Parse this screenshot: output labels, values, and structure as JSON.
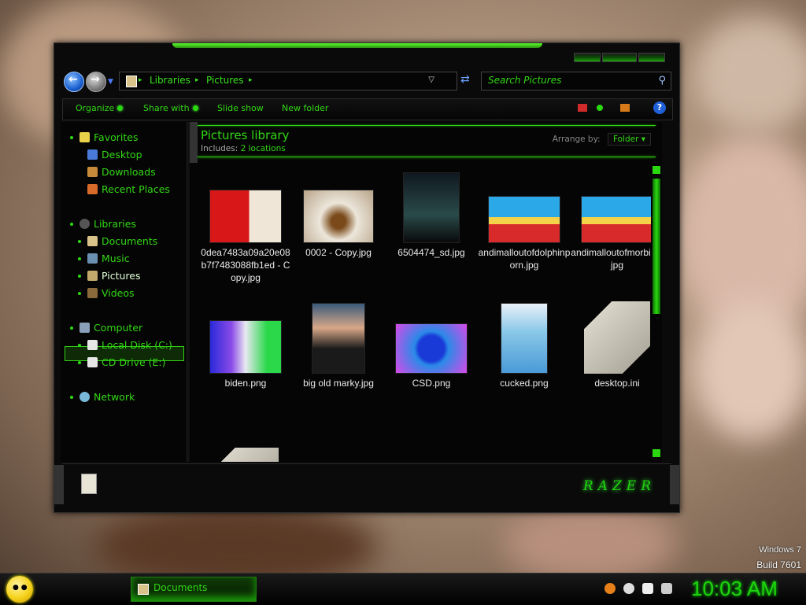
{
  "window": {
    "address": {
      "crumbs": [
        "Libraries",
        "Pictures"
      ]
    },
    "search": {
      "placeholder": "Search Pictures"
    },
    "toolbar": {
      "organize": "Organize",
      "share_with": "Share with",
      "slide_show": "Slide show",
      "new_folder": "New folder"
    },
    "nav": {
      "favorites": "Favorites",
      "desktop": "Desktop",
      "downloads": "Downloads",
      "recent_places": "Recent Places",
      "libraries": "Libraries",
      "documents": "Documents",
      "music": "Music",
      "pictures": "Pictures",
      "videos": "Videos",
      "computer": "Computer",
      "local_disk": "Local Disk (C:)",
      "cd_drive": "CD Drive (E:)",
      "network": "Network"
    },
    "library": {
      "title": "Pictures library",
      "includes_label": "Includes:",
      "includes_value": "2 locations",
      "arrange_label": "Arrange by:",
      "arrange_value": "Folder"
    },
    "files": [
      {
        "name": "0dea7483a09a20e08b7f7483088fb1ed - Copy.jpg"
      },
      {
        "name": "0002 - Copy.jpg"
      },
      {
        "name": "6504474_sd.jpg"
      },
      {
        "name": "andimalloutofdolphinporn.jpg"
      },
      {
        "name": "andimalloutofmorbius.jpg"
      },
      {
        "name": "biden.png"
      },
      {
        "name": "big old marky.jpg"
      },
      {
        "name": "CSD.png"
      },
      {
        "name": "cucked.png"
      },
      {
        "name": "desktop.ini"
      }
    ],
    "brand": "RAZER"
  },
  "desktop": {
    "watermark_line1": "Windows 7",
    "watermark_line2": "Build 7601"
  },
  "taskbar": {
    "task_label": "Documents",
    "clock": "10:03 AM"
  },
  "colors": {
    "accent": "#32d714",
    "window_bg": "#0a0a0a"
  }
}
